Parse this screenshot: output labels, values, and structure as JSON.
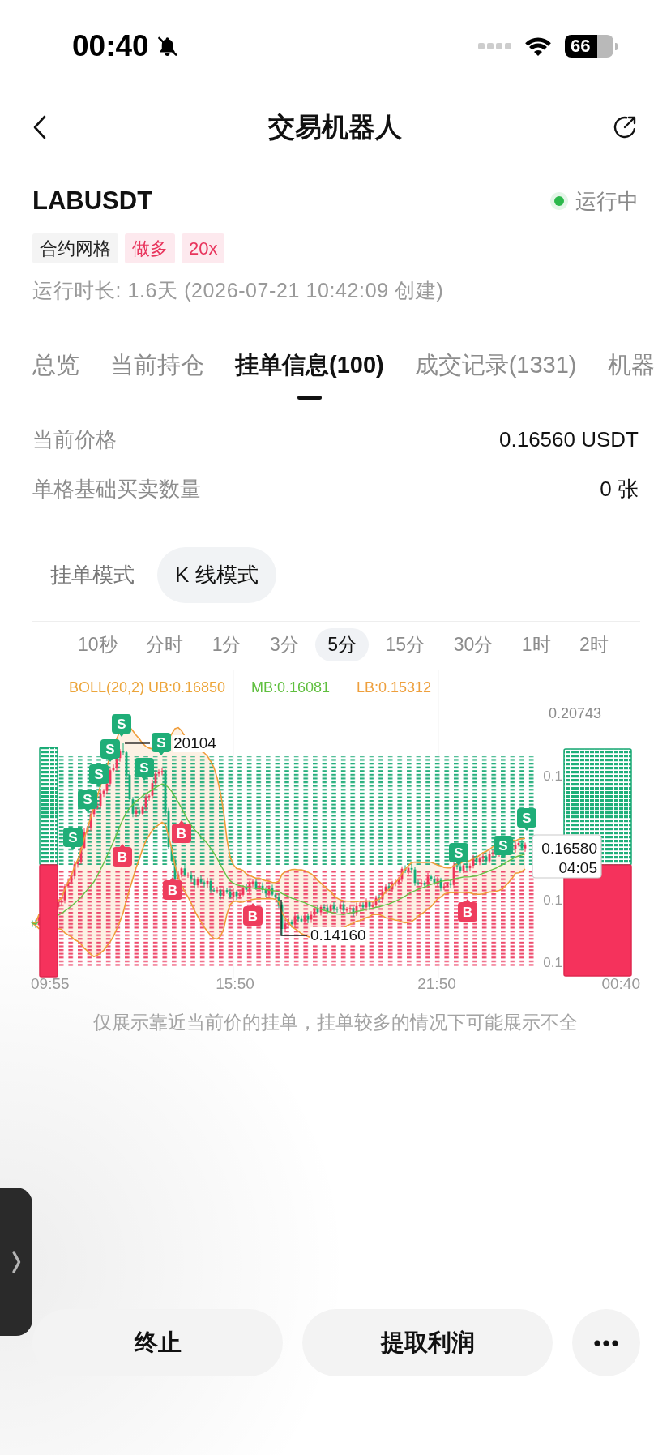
{
  "status_bar": {
    "time": "00:40",
    "battery": "66"
  },
  "header": {
    "title": "交易机器人"
  },
  "bot": {
    "symbol": "LABUSDT",
    "status": {
      "label": "运行中",
      "running": true
    },
    "tags": [
      {
        "label": "合约网格",
        "kind": "type"
      },
      {
        "label": "做多",
        "kind": "side"
      },
      {
        "label": "20x",
        "kind": "leverage"
      }
    ],
    "runtime": "运行时长: 1.6天 (2026-07-21 10:42:09 创建)"
  },
  "tabs": [
    {
      "label": "总览",
      "selected": false
    },
    {
      "label": "当前持仓",
      "selected": false
    },
    {
      "label": "挂单信息(100)",
      "selected": true
    },
    {
      "label": "成交记录(1331)",
      "selected": false
    },
    {
      "label": "机器",
      "selected": false
    }
  ],
  "info_rows": [
    {
      "label": "当前价格",
      "value": "0.16560 USDT"
    },
    {
      "label": "单格基础买卖数量",
      "value": "0 张"
    }
  ],
  "view_modes": [
    {
      "label": "挂单模式",
      "selected": false
    },
    {
      "label": "K 线模式",
      "selected": true
    }
  ],
  "intervals": [
    {
      "label": "10秒",
      "selected": false
    },
    {
      "label": "分时",
      "selected": false
    },
    {
      "label": "1分",
      "selected": false
    },
    {
      "label": "3分",
      "selected": false
    },
    {
      "label": "5分",
      "selected": true
    },
    {
      "label": "15分",
      "selected": false
    },
    {
      "label": "30分",
      "selected": false
    },
    {
      "label": "1时",
      "selected": false
    },
    {
      "label": "2时",
      "selected": false
    }
  ],
  "chart": {
    "legend": [
      {
        "kind": "upper",
        "text": "BOLL(20,2) UB:0.16850"
      },
      {
        "kind": "middle",
        "text": "MB:0.16081"
      },
      {
        "kind": "lower",
        "text": "LB:0.15312"
      }
    ],
    "max_price": "0.20743",
    "high_mark": "20104",
    "low_mark": "0.14160",
    "y_labels": [
      "0.1",
      "0.1",
      "0.1"
    ],
    "price_tag": {
      "price": "0.16580",
      "countdown": "04:05"
    },
    "x_labels": [
      "09:55",
      "15:50",
      "21:50",
      "00:40"
    ],
    "markers": [
      {
        "kind": "sell",
        "label": "S"
      },
      {
        "kind": "sell",
        "label": "S"
      },
      {
        "kind": "sell",
        "label": "S"
      },
      {
        "kind": "sell",
        "label": "S"
      },
      {
        "kind": "sell",
        "label": "S"
      },
      {
        "kind": "sell",
        "label": "S"
      },
      {
        "kind": "sell",
        "label": "S"
      },
      {
        "kind": "sell",
        "label": "S"
      },
      {
        "kind": "sell",
        "label": "S"
      },
      {
        "kind": "sell",
        "label": "S"
      },
      {
        "kind": "buy",
        "label": "B"
      },
      {
        "kind": "buy",
        "label": "B"
      },
      {
        "kind": "buy",
        "label": "B"
      },
      {
        "kind": "buy",
        "label": "B"
      },
      {
        "kind": "buy",
        "label": "B"
      }
    ]
  },
  "note": "仅展示靠近当前价的挂单，挂单较多的情况下可能展示不全",
  "actions": [
    {
      "kind": "text",
      "label": "终止"
    },
    {
      "kind": "text",
      "label": "提取利润"
    },
    {
      "kind": "more"
    }
  ]
}
